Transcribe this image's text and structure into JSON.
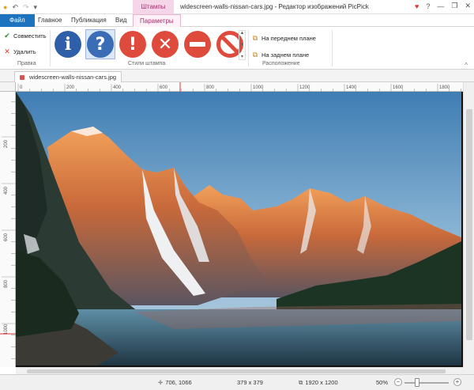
{
  "window": {
    "title": "widescreen-walls-nissan-cars.jpg - Редактор изображений PicPick",
    "context_tab_group": "Штампы"
  },
  "tabs": {
    "file": "Файл",
    "home": "Главное",
    "publication": "Публикация",
    "view": "Вид",
    "params": "Параметры"
  },
  "ribbon": {
    "edit_group": {
      "combine": "Совместить",
      "delete": "Удалить",
      "label": "Правка"
    },
    "stamps_group": {
      "label": "Стили штампа",
      "stamps": [
        "info-stamp",
        "question-stamp",
        "exclamation-stamp",
        "cross-stamp",
        "minus-stamp",
        "no-entry-stamp"
      ],
      "selected_index": 1
    },
    "arrange_group": {
      "front": "На переднем плане",
      "back": "На заднем плане",
      "label": "Расположение"
    }
  },
  "document": {
    "tab_label": "widescreen-walls-nissan-cars.jpg"
  },
  "ruler": {
    "h_labels": [
      "0",
      "200",
      "400",
      "600",
      "800",
      "1000",
      "1200",
      "1400",
      "1600",
      "1800"
    ],
    "v_labels": [
      "200",
      "400",
      "600",
      "800",
      "1000"
    ]
  },
  "status": {
    "cursor": "706, 1066",
    "selection": "379 x 379",
    "image_size": "1920 x 1200",
    "zoom": "50%"
  },
  "colors": {
    "file_tab": "#1e73be",
    "context_tab": "#a0326e",
    "stamp_red": "#de4a3b",
    "stamp_blue": "#3a6db5"
  }
}
